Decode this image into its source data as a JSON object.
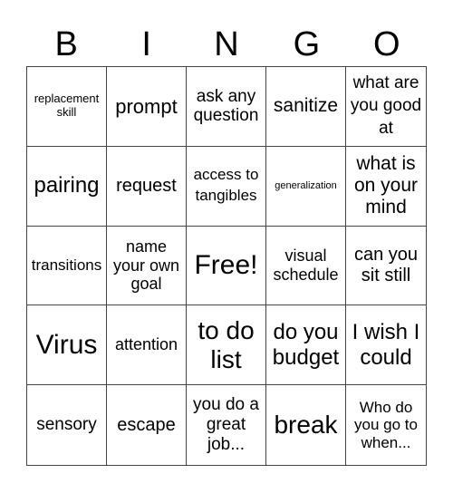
{
  "header": {
    "letters": [
      "B",
      "I",
      "N",
      "G",
      "O"
    ]
  },
  "cells": [
    "replacement skill",
    "prompt",
    "ask any question",
    "sanitize",
    "what are you good at",
    "pairing",
    "request",
    "access to tangibles",
    "generalization",
    "what is on your mind",
    "transitions",
    "name your own goal",
    "Free!",
    "visual schedule",
    "can you sit still",
    "Virus",
    "attention",
    "to do list",
    "do you budget",
    "I wish I could",
    "sensory",
    "escape",
    "you do a great job...",
    "break",
    "Who do you go to when..."
  ]
}
